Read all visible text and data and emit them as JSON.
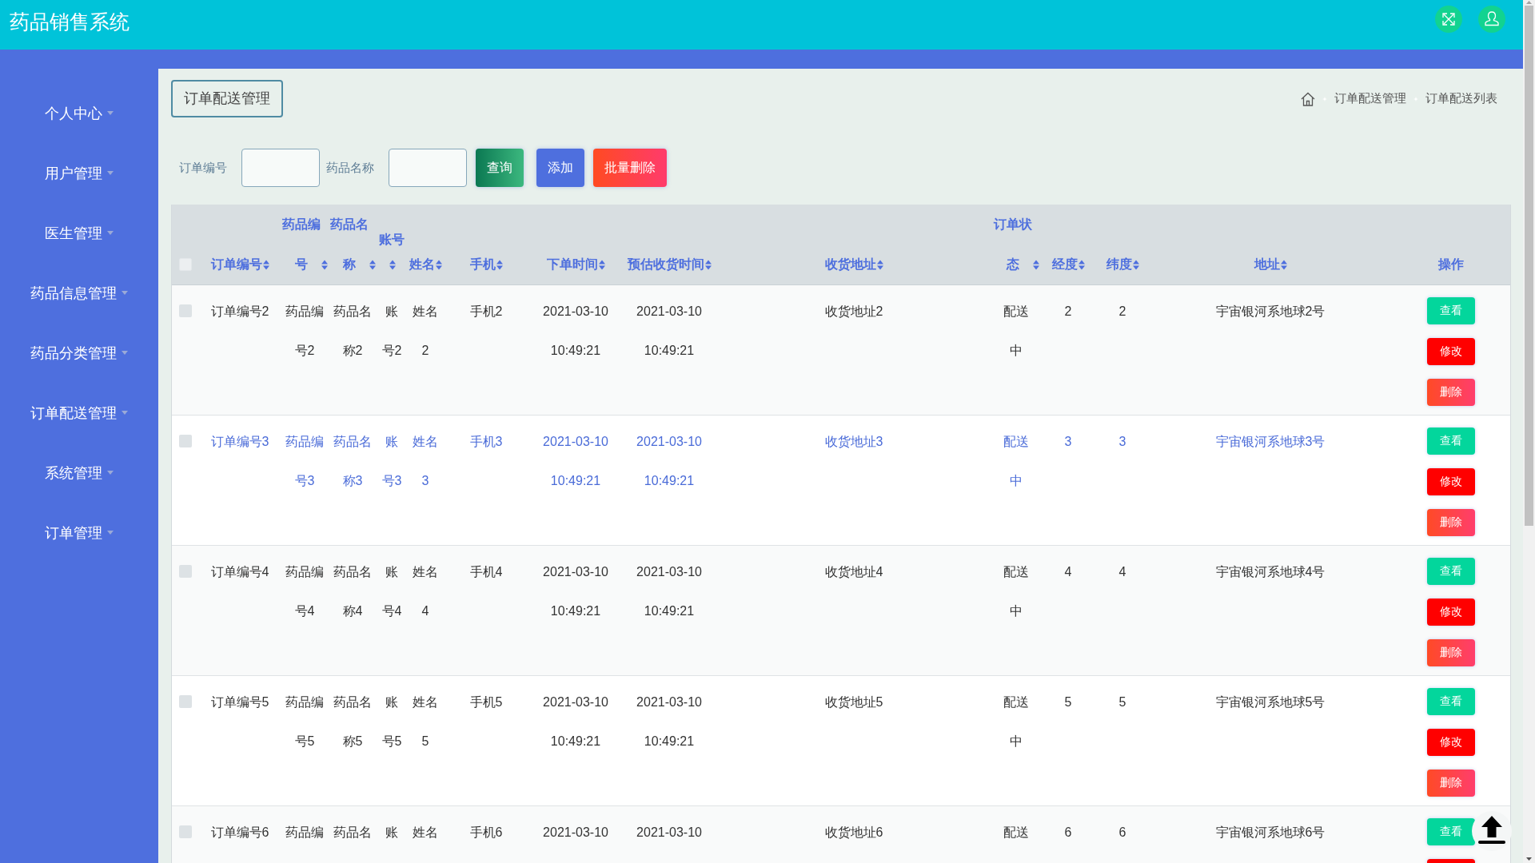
{
  "app": {
    "title": "药品销售系统"
  },
  "sidebar": {
    "items": [
      "个人中心",
      "用户管理",
      "医生管理",
      "药品信息管理",
      "药品分类管理",
      "订单配送管理",
      "系统管理",
      "订单管理"
    ]
  },
  "page": {
    "title": "订单配送管理",
    "breadcrumb": [
      "订单配送管理",
      "订单配送列表"
    ]
  },
  "search": {
    "fields": [
      {
        "label": "订单编号"
      },
      {
        "label": "药品名称"
      }
    ],
    "buttons": [
      {
        "label": "查询",
        "kind": "search"
      },
      {
        "label": "添加",
        "kind": "add"
      },
      {
        "label": "批量删除",
        "kind": "batch-delete"
      }
    ]
  },
  "table": {
    "select_all": {
      "checked": false
    },
    "columns": [
      {
        "label": "订单编号",
        "sortable": true
      },
      {
        "label": "药品编号",
        "sortable": true
      },
      {
        "label": "药品名称",
        "sortable": true
      },
      {
        "label": "账号",
        "sortable": true
      },
      {
        "label": "姓名",
        "sortable": true
      },
      {
        "label": "手机",
        "sortable": true
      },
      {
        "label": "下单时间",
        "sortable": true
      },
      {
        "label": "预估收货时间",
        "sortable": true
      },
      {
        "label": "收货地址",
        "sortable": true
      },
      {
        "label": "订单状态",
        "sortable": true
      },
      {
        "label": "经度",
        "sortable": true
      },
      {
        "label": "纬度",
        "sortable": true
      },
      {
        "label": "地址",
        "sortable": true
      },
      {
        "label": "操作",
        "sortable": false
      }
    ],
    "rows": [
      {
        "checked": false,
        "hovered": false,
        "cells": [
          "订单编号2",
          "药品编号2",
          "药品名称2",
          "账号2",
          "姓名2",
          "手机2",
          "2021-03-10 10:49:21",
          "2021-03-10 10:49:21",
          "收货地址2",
          "配送中",
          "2",
          "2",
          "宇宙银河系地球2号"
        ],
        "actions": [
          {
            "label": "查看",
            "kind": "view"
          },
          {
            "label": "修改",
            "kind": "edit"
          },
          {
            "label": "删除",
            "kind": "delete"
          }
        ]
      },
      {
        "checked": false,
        "hovered": true,
        "cells": [
          "订单编号3",
          "药品编号3",
          "药品名称3",
          "账号3",
          "姓名3",
          "手机3",
          "2021-03-10 10:49:21",
          "2021-03-10 10:49:21",
          "收货地址3",
          "配送中",
          "3",
          "3",
          "宇宙银河系地球3号"
        ],
        "actions": [
          {
            "label": "查看",
            "kind": "view"
          },
          {
            "label": "修改",
            "kind": "edit"
          },
          {
            "label": "删除",
            "kind": "delete"
          }
        ]
      },
      {
        "checked": false,
        "hovered": false,
        "cells": [
          "订单编号4",
          "药品编号4",
          "药品名称4",
          "账号4",
          "姓名4",
          "手机4",
          "2021-03-10 10:49:21",
          "2021-03-10 10:49:21",
          "收货地址4",
          "配送中",
          "4",
          "4",
          "宇宙银河系地球4号"
        ],
        "actions": [
          {
            "label": "查看",
            "kind": "view"
          },
          {
            "label": "修改",
            "kind": "edit"
          },
          {
            "label": "删除",
            "kind": "delete"
          }
        ]
      },
      {
        "checked": false,
        "hovered": false,
        "cells": [
          "订单编号5",
          "药品编号5",
          "药品名称5",
          "账号5",
          "姓名5",
          "手机5",
          "2021-03-10 10:49:21",
          "2021-03-10 10:49:21",
          "收货地址5",
          "配送中",
          "5",
          "5",
          "宇宙银河系地球5号"
        ],
        "actions": [
          {
            "label": "查看",
            "kind": "view"
          },
          {
            "label": "修改",
            "kind": "edit"
          },
          {
            "label": "删除",
            "kind": "delete"
          }
        ]
      },
      {
        "checked": false,
        "hovered": false,
        "cells": [
          "订单编号6",
          "药品编",
          "药品名",
          "账",
          "姓名",
          "手机6",
          "2021-03-10",
          "2021-03-10",
          "收货地址6",
          "配送",
          "6",
          "6",
          "宇宙银河系地球6号"
        ],
        "actions": [
          {
            "label": "查看",
            "kind": "view"
          },
          {
            "kind": "edit"
          }
        ]
      }
    ]
  }
}
